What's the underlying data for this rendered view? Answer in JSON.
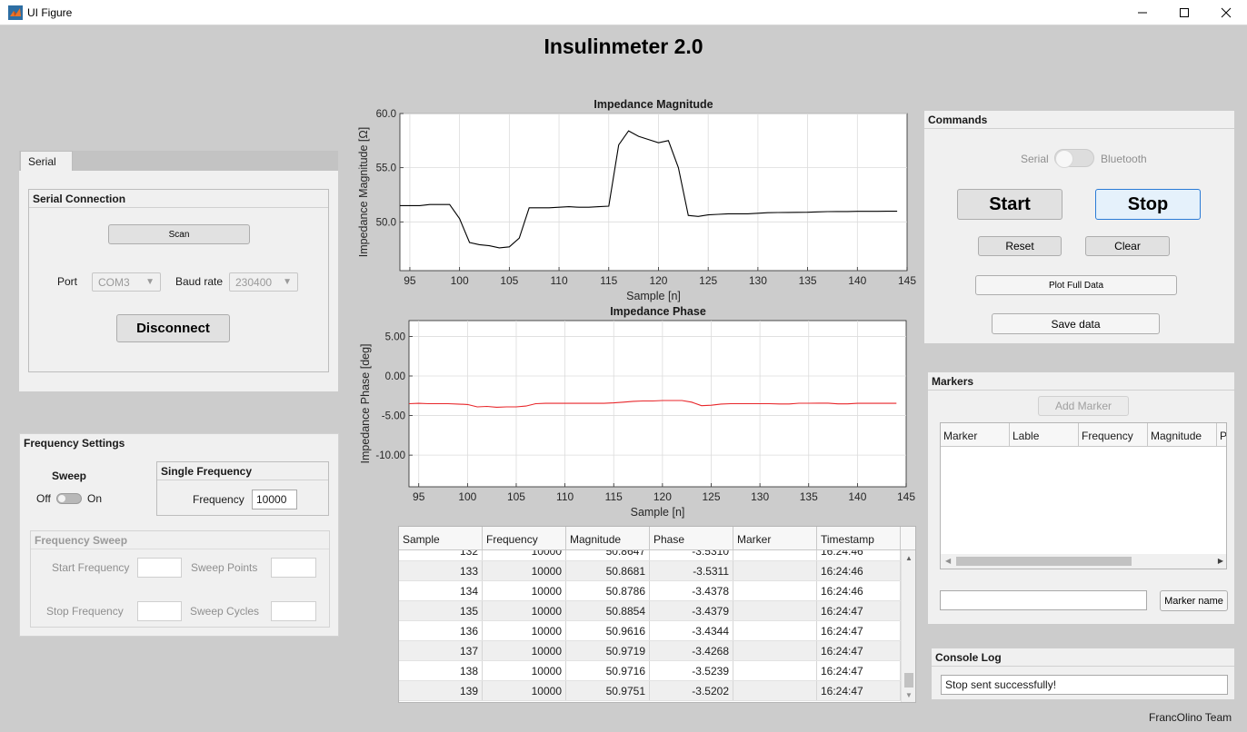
{
  "window": {
    "title": "UI Figure",
    "icon": "matlab-icon"
  },
  "app_title": "Insulinmeter 2.0",
  "serial_tab": {
    "tab_label": "Serial",
    "connection_title": "Serial Connection",
    "scan_label": "Scan",
    "port_label": "Port",
    "port_value": "COM3",
    "baud_label": "Baud rate",
    "baud_value": "230400",
    "disconnect_label": "Disconnect"
  },
  "frequency": {
    "title": "Frequency Settings",
    "sweep_label": "Sweep",
    "off_label": "Off",
    "on_label": "On",
    "single_title": "Single Frequency",
    "frequency_label": "Frequency",
    "frequency_value": "10000",
    "sweep_title": "Frequency Sweep",
    "start_label": "Start Frequency",
    "points_label": "Sweep Points",
    "stop_label": "Stop Frequency",
    "cycles_label": "Sweep Cycles"
  },
  "commands": {
    "title": "Commands",
    "serial_label": "Serial",
    "bluetooth_label": "Bluetooth",
    "start_label": "Start",
    "stop_label": "Stop",
    "reset_label": "Reset",
    "clear_label": "Clear",
    "plot_full_label": "Plot Full Data",
    "save_label": "Save data"
  },
  "markers": {
    "title": "Markers",
    "add_label": "Add Marker",
    "columns": [
      "Marker",
      "Lable",
      "Frequency",
      "Magnitude",
      "P"
    ],
    "name_button": "Marker name",
    "name_value": ""
  },
  "console": {
    "title": "Console Log",
    "message": "Stop sent successfully!"
  },
  "footer": "FrancOlino Team",
  "table": {
    "columns": [
      "Sample",
      "Frequency",
      "Magnitude",
      "Phase",
      "Marker",
      "Timestamp"
    ],
    "partial_row": [
      "132",
      "10000",
      "50.8647",
      "-3.5310",
      "",
      "16:24:46"
    ],
    "rows": [
      [
        "133",
        "10000",
        "50.8681",
        "-3.5311",
        "",
        "16:24:46"
      ],
      [
        "134",
        "10000",
        "50.8786",
        "-3.4378",
        "",
        "16:24:46"
      ],
      [
        "135",
        "10000",
        "50.8854",
        "-3.4379",
        "",
        "16:24:47"
      ],
      [
        "136",
        "10000",
        "50.9616",
        "-3.4344",
        "",
        "16:24:47"
      ],
      [
        "137",
        "10000",
        "50.9719",
        "-3.4268",
        "",
        "16:24:47"
      ],
      [
        "138",
        "10000",
        "50.9716",
        "-3.5239",
        "",
        "16:24:47"
      ],
      [
        "139",
        "10000",
        "50.9751",
        "-3.5202",
        "",
        "16:24:47"
      ]
    ]
  },
  "chart_data": [
    {
      "type": "line",
      "title": "Impedance Magnitude",
      "xlabel": "Sample [n]",
      "ylabel": "Impedance Magnitude [Ω]",
      "xlim": [
        94,
        145
      ],
      "ylim": [
        45.5,
        60
      ],
      "xticks": [
        95,
        100,
        105,
        110,
        115,
        120,
        125,
        130,
        135,
        140,
        145
      ],
      "yticks": [
        50.0,
        55.0,
        60.0
      ],
      "ytick_labels": [
        "50.0",
        "55.0",
        "60.0"
      ],
      "grid": true,
      "color": "#000000",
      "x": [
        94,
        95,
        96,
        97,
        98,
        99,
        100,
        101,
        102,
        103,
        104,
        105,
        106,
        107,
        108,
        109,
        110,
        111,
        112,
        113,
        114,
        115,
        116,
        117,
        118,
        119,
        120,
        121,
        122,
        123,
        124,
        125,
        126,
        127,
        128,
        129,
        130,
        131,
        132,
        133,
        134,
        135,
        136,
        137,
        138,
        139,
        140,
        141,
        142,
        143,
        144
      ],
      "y": [
        51.5,
        51.5,
        51.5,
        51.6,
        51.6,
        51.6,
        50.3,
        48.1,
        47.9,
        47.8,
        47.6,
        47.7,
        48.5,
        51.3,
        51.3,
        51.3,
        51.35,
        51.4,
        51.35,
        51.35,
        51.4,
        51.45,
        57.1,
        58.4,
        57.9,
        57.6,
        57.3,
        57.5,
        55.0,
        50.6,
        50.5,
        50.65,
        50.7,
        50.75,
        50.75,
        50.75,
        50.8,
        50.85,
        50.86,
        50.87,
        50.88,
        50.89,
        50.92,
        50.95,
        50.96,
        50.96,
        50.97,
        50.97,
        50.97,
        50.98,
        50.98
      ]
    },
    {
      "type": "line",
      "title": "Impedance Phase",
      "xlabel": "Sample [n]",
      "ylabel": "Impedance Phase [deg]",
      "xlim": [
        94,
        145
      ],
      "ylim": [
        -14,
        7
      ],
      "xticks": [
        95,
        100,
        105,
        110,
        115,
        120,
        125,
        130,
        135,
        140,
        145
      ],
      "yticks": [
        -10,
        -5,
        0,
        5
      ],
      "ytick_labels": [
        "-10.00",
        "-5.00",
        "0.00",
        "5.00"
      ],
      "grid": true,
      "color": "#e8262a",
      "x": [
        94,
        95,
        96,
        97,
        98,
        99,
        100,
        101,
        102,
        103,
        104,
        105,
        106,
        107,
        108,
        109,
        110,
        111,
        112,
        113,
        114,
        115,
        116,
        117,
        118,
        119,
        120,
        121,
        122,
        123,
        124,
        125,
        126,
        127,
        128,
        129,
        130,
        131,
        132,
        133,
        134,
        135,
        136,
        137,
        138,
        139,
        140,
        141,
        142,
        143,
        144
      ],
      "y": [
        -3.5,
        -3.45,
        -3.5,
        -3.5,
        -3.5,
        -3.55,
        -3.6,
        -3.9,
        -3.85,
        -3.95,
        -3.9,
        -3.9,
        -3.8,
        -3.5,
        -3.45,
        -3.45,
        -3.45,
        -3.45,
        -3.45,
        -3.45,
        -3.45,
        -3.4,
        -3.3,
        -3.2,
        -3.15,
        -3.15,
        -3.1,
        -3.1,
        -3.1,
        -3.3,
        -3.75,
        -3.7,
        -3.55,
        -3.5,
        -3.5,
        -3.5,
        -3.5,
        -3.5,
        -3.53,
        -3.53,
        -3.44,
        -3.44,
        -3.43,
        -3.43,
        -3.52,
        -3.52,
        -3.45,
        -3.45,
        -3.45,
        -3.45,
        -3.45
      ]
    }
  ]
}
